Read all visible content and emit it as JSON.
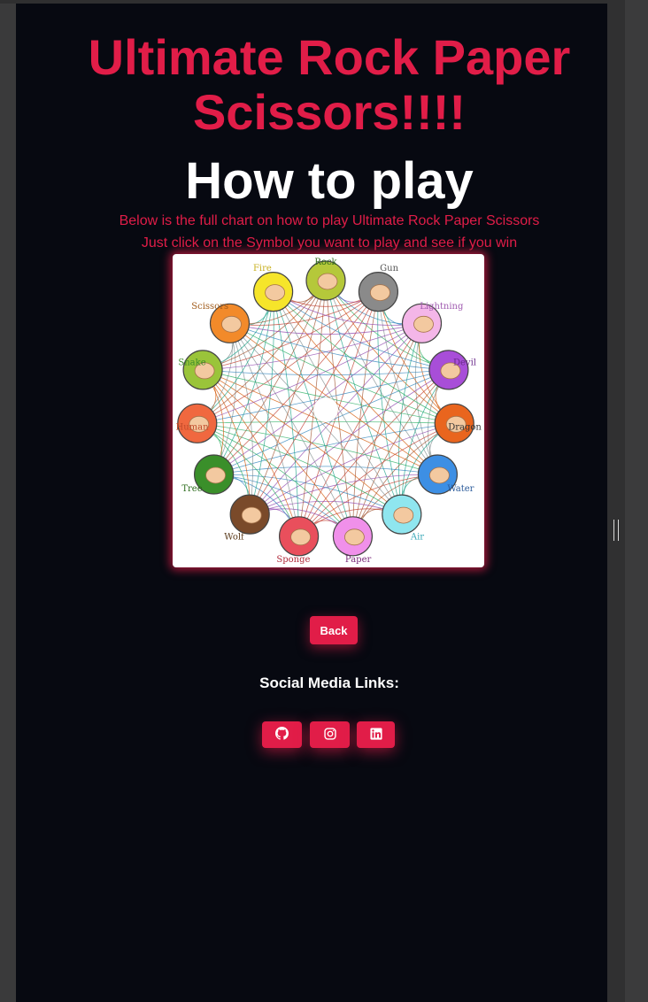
{
  "header": {
    "title": "Ultimate Rock Paper Scissors!!!!",
    "subtitle": "How to play"
  },
  "instructions": {
    "line1": "Below is the full chart on how to play Ultimate Rock Paper Scissors",
    "line2": "Just click on the Symbol you want to play and see if you win"
  },
  "chart_image": {
    "labels": [
      "Rock",
      "Gun",
      "Lightning",
      "Devil",
      "Dragon",
      "Water",
      "Air",
      "Paper",
      "Sponge",
      "Wolf",
      "Tree",
      "Human",
      "Snake",
      "Scissors",
      "Fire"
    ],
    "colors": [
      "#b5c83a",
      "#8a8a8a",
      "#f4b6e8",
      "#a84ed8",
      "#e9651e",
      "#3d8fe4",
      "#8fe6ef",
      "#f090ea",
      "#e94f5c",
      "#7a4a2a",
      "#3a8f2a",
      "#f0683f",
      "#9ac43a",
      "#f28a2a",
      "#f6e52a"
    ],
    "label_colors": [
      "#2d6a1a",
      "#555555",
      "#a05bb0",
      "#6a2a8a",
      "#333333",
      "#2a5a9a",
      "#3aa8b8",
      "#7a2a7a",
      "#b02a3a",
      "#5a3a1a",
      "#2a6a1a",
      "#c04a2a",
      "#3a8a2a",
      "#a05a1a",
      "#c8b020"
    ]
  },
  "buttons": {
    "back": "Back"
  },
  "social": {
    "title": "Social Media Links:",
    "links": [
      {
        "icon": "github-icon"
      },
      {
        "icon": "instagram-icon"
      },
      {
        "icon": "linkedin-icon"
      }
    ]
  },
  "colors": {
    "accent": "#e11d48",
    "background": "#070911",
    "text": "#ffffff"
  }
}
